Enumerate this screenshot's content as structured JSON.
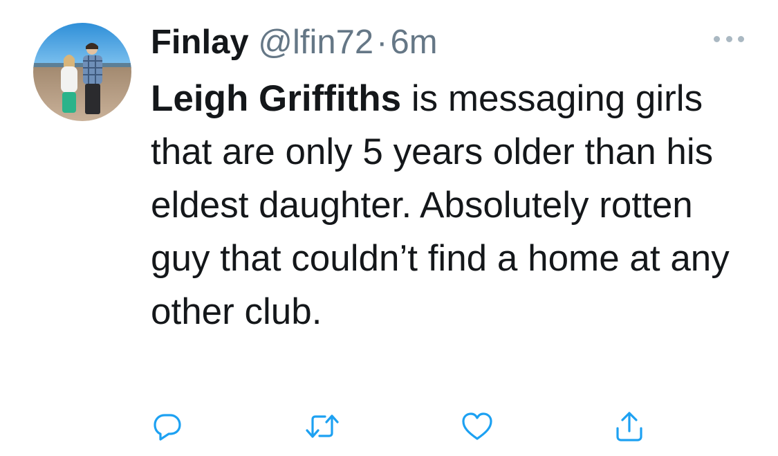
{
  "tweet": {
    "display_name": "Finlay",
    "handle": "@lfin72",
    "separator": "·",
    "time": "6m",
    "mention": "Leigh Griffiths",
    "text": " is messaging girls that are only 5 years older than his eldest daughter. Absolutely rotten guy that couldn’t find a home at any other club."
  },
  "icons": {
    "more": "more-horizontal-icon",
    "reply": "reply-icon",
    "retweet": "retweet-icon",
    "like": "heart-icon",
    "share": "share-icon"
  },
  "colors": {
    "text": "#14171a",
    "secondary": "#657786",
    "action_icon": "#1da1f2",
    "more_dots": "#aab8c2"
  }
}
